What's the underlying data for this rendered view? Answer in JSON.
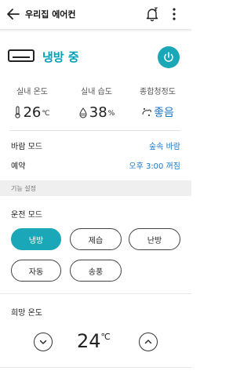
{
  "header": {
    "title": "우리집 에어컨"
  },
  "status": {
    "label": "냉방 중",
    "accent": "#1aa7b8"
  },
  "metrics": [
    {
      "label": "실내 온도",
      "value": "26",
      "unit": "℃",
      "icon": "thermometer-icon"
    },
    {
      "label": "실내 습도",
      "value": "38",
      "unit": "%",
      "icon": "droplet-icon"
    },
    {
      "label": "종합청정도",
      "value": "좋음",
      "icon": "air-quality-icon"
    }
  ],
  "settings": [
    {
      "key": "바람 모드",
      "value": "숲속 바람"
    },
    {
      "key": "예약",
      "value": "오후 3:00 꺼짐"
    }
  ],
  "section": {
    "title": "기능 설정"
  },
  "operation_mode": {
    "title": "운전 모드",
    "options": [
      "냉방",
      "제습",
      "난방",
      "자동",
      "송풍"
    ],
    "selected": "냉방"
  },
  "target_temp": {
    "title": "희망 온도",
    "value": "24",
    "unit": "℃"
  }
}
